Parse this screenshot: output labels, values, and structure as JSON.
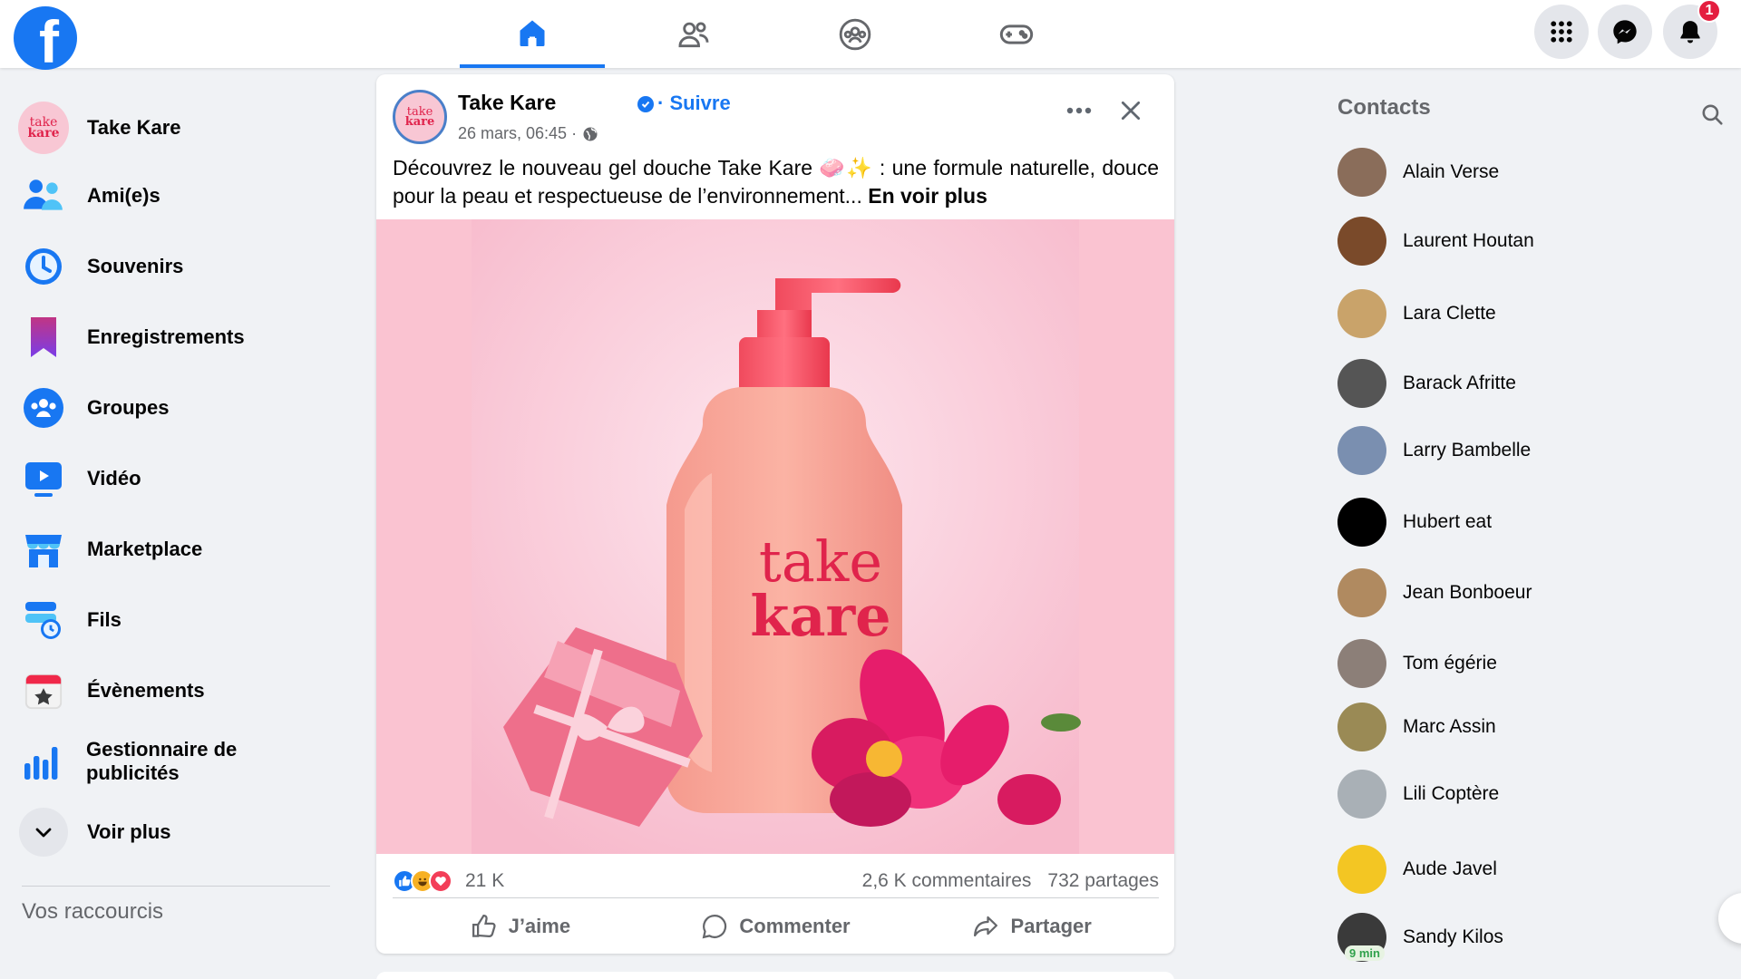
{
  "topbar": {
    "logo_letter": "f",
    "notifications_count": "1",
    "tabs": [
      "home-icon",
      "friends-icon",
      "groups-icon",
      "gaming-icon"
    ]
  },
  "sidebar": {
    "profile": {
      "name": "Take Kare",
      "avatar_line1": "take",
      "avatar_line2": "kare"
    },
    "items": [
      {
        "label": "Ami(e)s",
        "icon": "friends-icon"
      },
      {
        "label": "Souvenirs",
        "icon": "memories-icon"
      },
      {
        "label": "Enregistrements",
        "icon": "saved-icon"
      },
      {
        "label": "Groupes",
        "icon": "groups-icon"
      },
      {
        "label": "Vidéo",
        "icon": "video-icon"
      },
      {
        "label": "Marketplace",
        "icon": "marketplace-icon"
      },
      {
        "label": "Fils",
        "icon": "feeds-icon"
      },
      {
        "label": "Évènements",
        "icon": "events-icon"
      },
      {
        "label": "Gestionnaire de publicités",
        "icon": "ads-manager-icon"
      },
      {
        "label": "Voir plus",
        "icon": "chevron-down-icon"
      }
    ],
    "shortcuts_title": "Vos raccourcis"
  },
  "post": {
    "author": "Take Kare",
    "avatar_line1": "take",
    "avatar_line2": "kare",
    "follow_label": "· Suivre",
    "time": "26 mars, 06:45 ·",
    "text_main": "Découvrez le nouveau gel douche Take Kare 🧼✨ : une formule naturelle, douce pour la peau et respectueuse de l’environnement...",
    "text_more": "En voir plus",
    "image_brand_line1": "take",
    "image_brand_line2": "kare",
    "reactions_count": "21 K",
    "comments": "2,6 K commentaires",
    "shares": "732 partages",
    "actions": {
      "like": "J’aime",
      "comment": "Commenter",
      "share": "Partager"
    }
  },
  "contacts": {
    "title": "Contacts",
    "list": [
      {
        "name": "Alain Verse",
        "color": "#8a6d5a"
      },
      {
        "name": "Laurent Houtan",
        "color": "#7a4a2a"
      },
      {
        "name": "Lara Clette",
        "color": "#c9a36a"
      },
      {
        "name": "Barack Afritte",
        "color": "#555555"
      },
      {
        "name": "Larry Bambelle",
        "color": "#7a8fb0"
      },
      {
        "name": "Hubert eat",
        "color": "#000000"
      },
      {
        "name": "Jean Bonboeur",
        "color": "#b08a60"
      },
      {
        "name": "Tom égérie",
        "color": "#8c7f78"
      },
      {
        "name": "Marc Assin",
        "color": "#9a8a55"
      },
      {
        "name": "Lili Coptère",
        "color": "#a9b0b6"
      },
      {
        "name": "Aude Javel",
        "color": "#f3c623"
      },
      {
        "name": "Sandy Kilos",
        "color": "#3a3a3a"
      }
    ],
    "last_active": "9 min"
  }
}
